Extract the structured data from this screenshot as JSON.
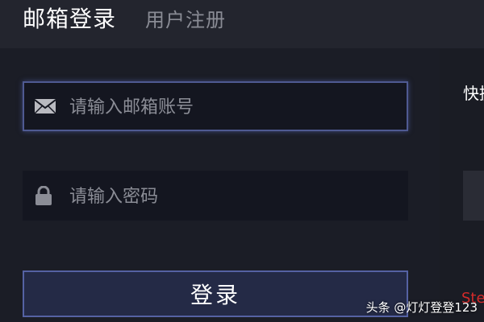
{
  "tabs": {
    "active_label": "邮箱登录",
    "inactive_label": "用户注册"
  },
  "email_field": {
    "placeholder": "请输入邮箱账号",
    "value": "",
    "icon": "mail-icon"
  },
  "password_field": {
    "placeholder": "请输入密码",
    "value": "",
    "icon": "lock-icon"
  },
  "login_button": {
    "label": "登录"
  },
  "side_panel": {
    "title": "快捷",
    "red_text": "Ste"
  },
  "watermark": "头条 @灯灯登登123",
  "colors": {
    "background": "#1b1d26",
    "field_background": "#141620",
    "focus_border": "#4f5a92",
    "button_background": "#242a46",
    "accent_red": "#d42a2a"
  }
}
